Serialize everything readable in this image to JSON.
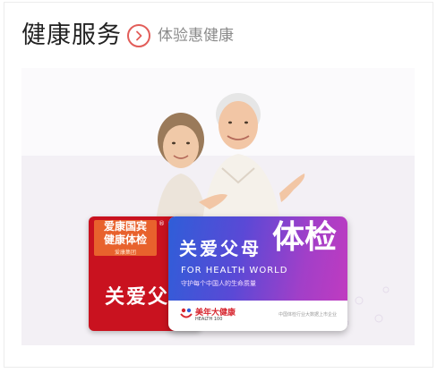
{
  "header": {
    "title": "健康服务",
    "subtitle": "体验惠健康",
    "arrow_icon": "chevron-right-circle-icon",
    "accent_color": "#e25d59"
  },
  "banner": {
    "red_card": {
      "tag_line1": "爱康国宾",
      "tag_line2": "健康体检",
      "tag_line3": "爱康集团",
      "registered_mark": "®",
      "big_text": "关爱父"
    },
    "main_card": {
      "heading": "关爱父母",
      "big_char": "体检",
      "english": "FOR HEALTH WORLD",
      "slogan": "守护每个中国人的生命质量",
      "logo_name": "美年大健康",
      "logo_en": "HEALTH 100",
      "footer": "中国体检行业大数据上市企业"
    }
  }
}
